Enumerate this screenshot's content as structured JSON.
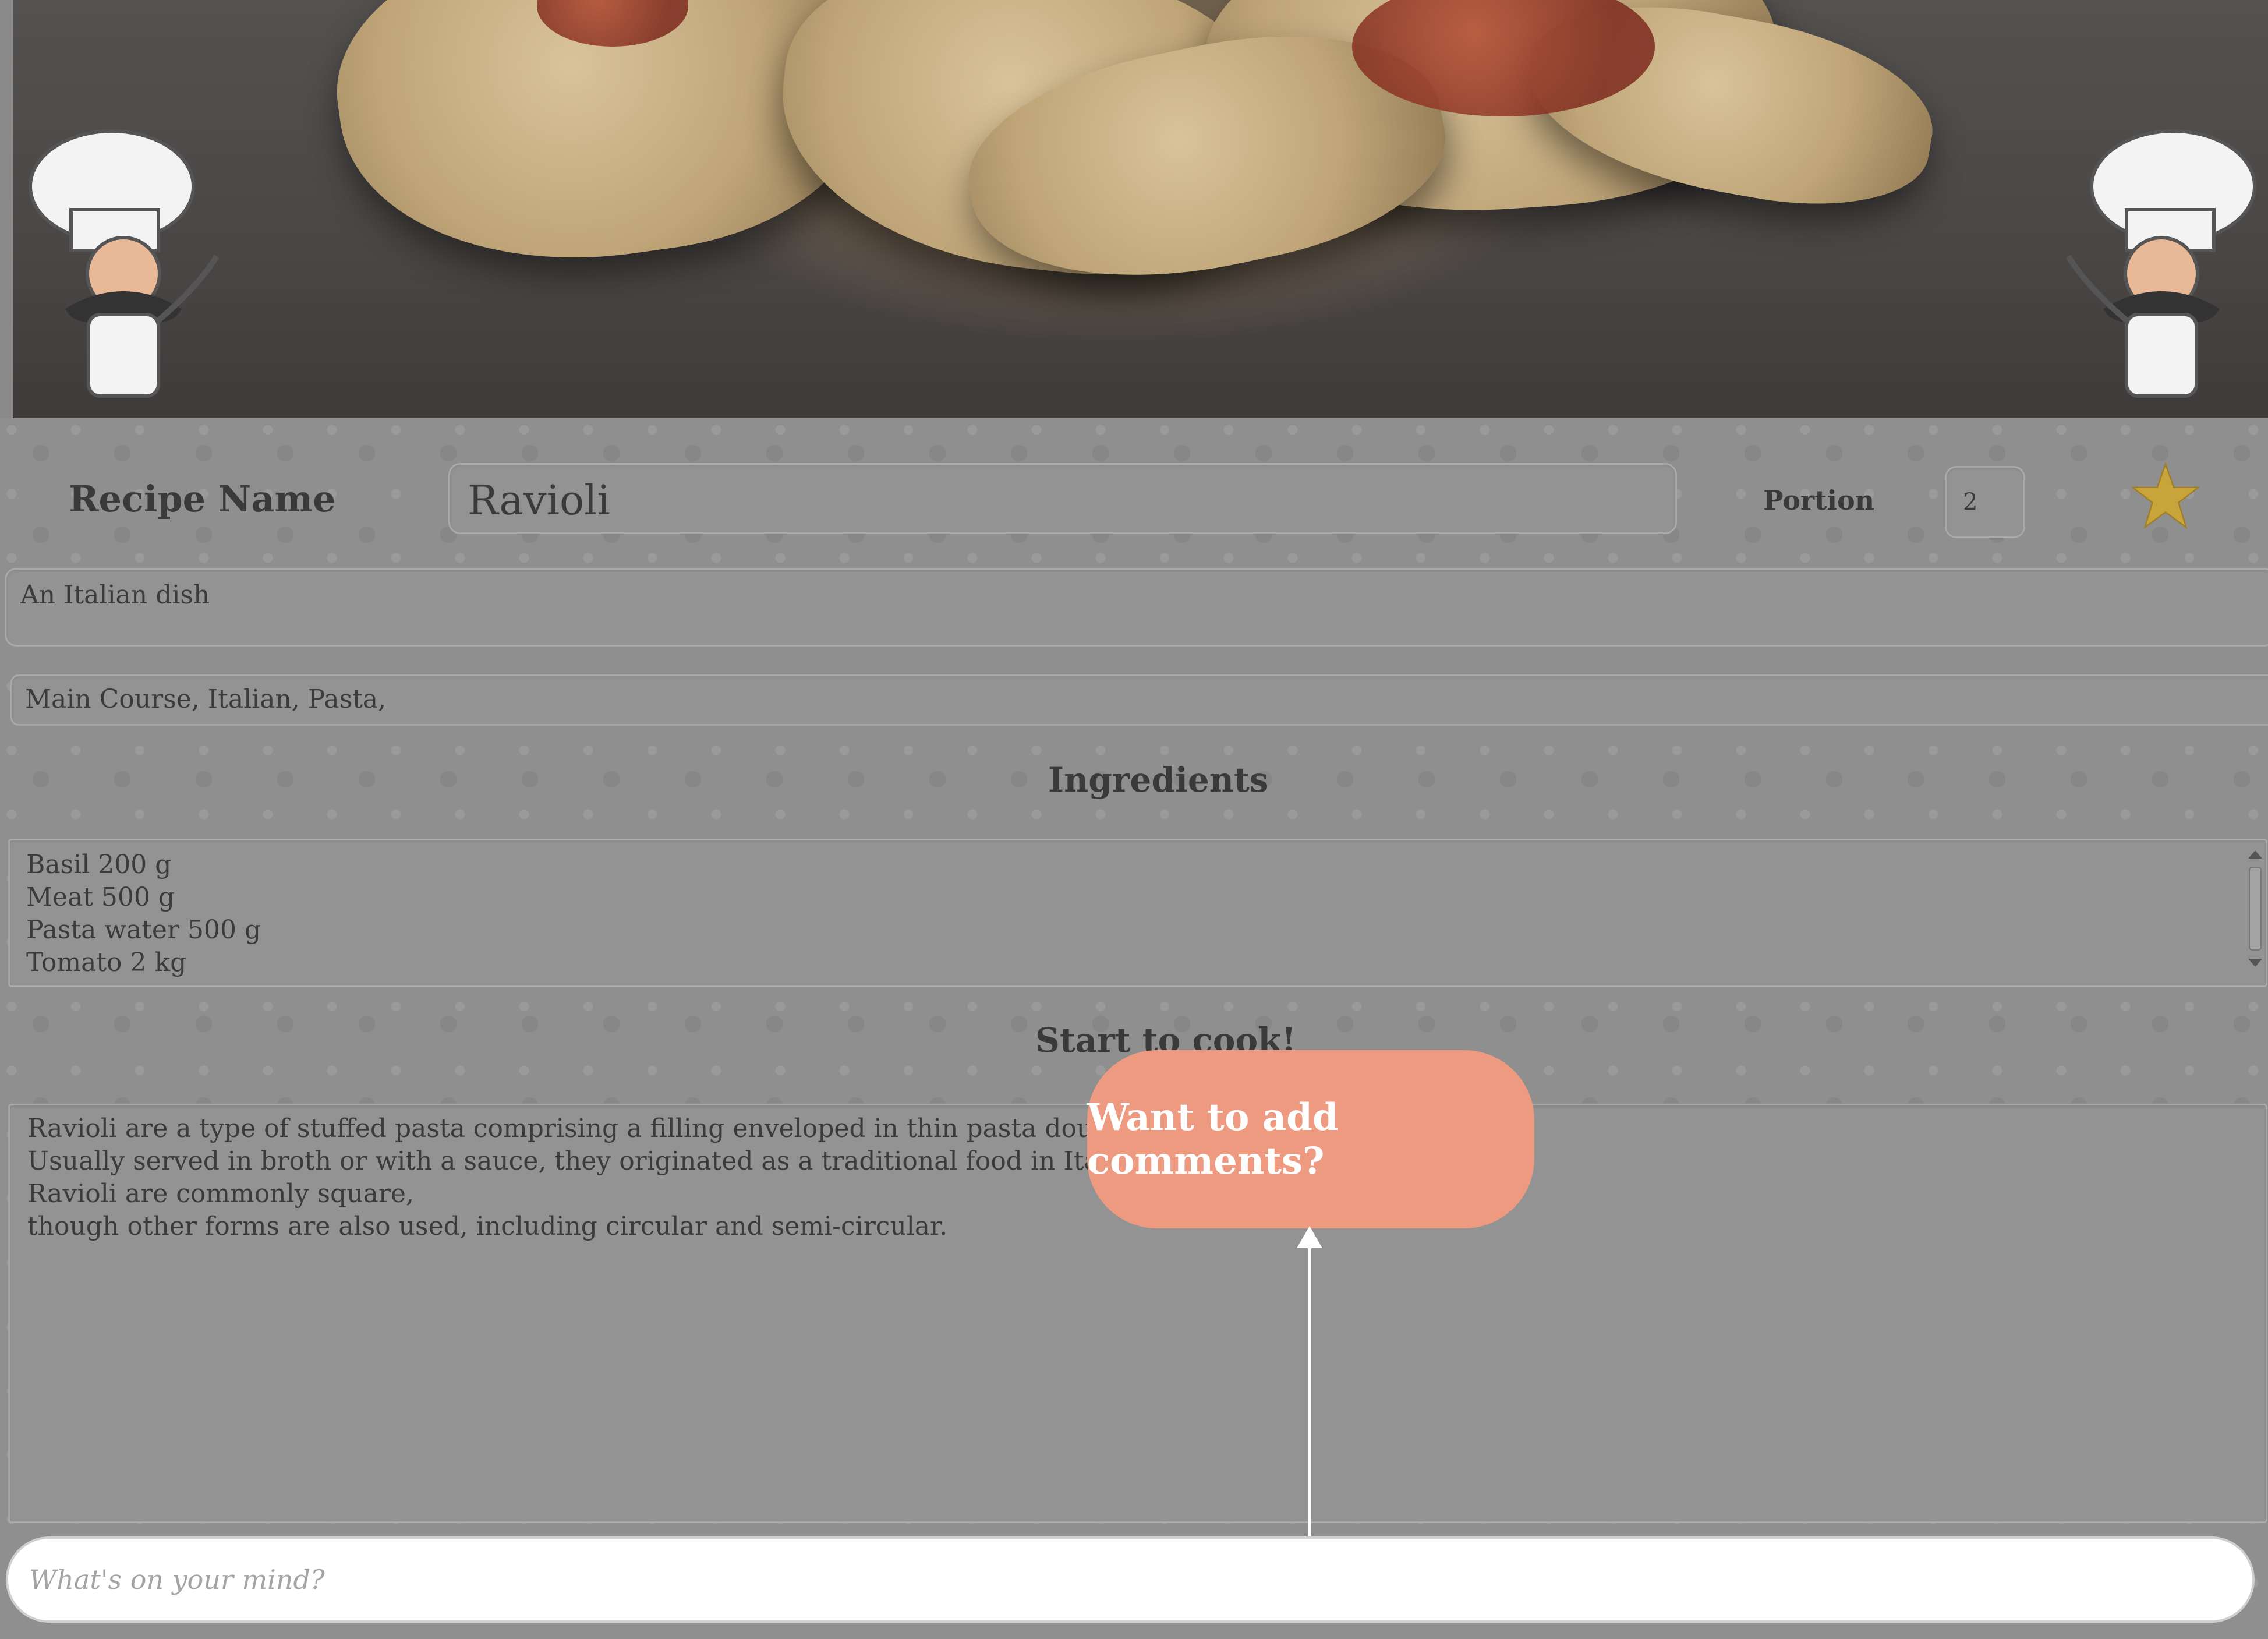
{
  "recipe": {
    "name_label": "Recipe Name",
    "name_value": "Ravioli",
    "portion_label": "Portion",
    "portion_value": "2",
    "description": "An Italian dish",
    "tags": "Main Course,  Italian,  Pasta,"
  },
  "ingredients": {
    "heading": "Ingredients",
    "items": [
      "Basil 200 g",
      "Meat 500 g",
      "Pasta water 500 g",
      "Tomato 2 kg"
    ]
  },
  "instructions": {
    "heading": "Start to cook!",
    "lines": [
      "Ravioli are a type of stuffed pasta comprising a filling enveloped in thin pasta dough.",
      "Usually served in broth or with a sauce, they originated as a traditional food in Italian cuisine",
      "Ravioli are commonly square,",
      "though other forms are also used, including circular and semi-circular."
    ]
  },
  "tooltip": {
    "text": "Want to add comments?"
  },
  "comment": {
    "placeholder": "What's on your mind?"
  },
  "colors": {
    "accent": "#ee9a80",
    "star": "#c9a43a"
  },
  "icons": [
    "chef-icon",
    "star-icon"
  ]
}
